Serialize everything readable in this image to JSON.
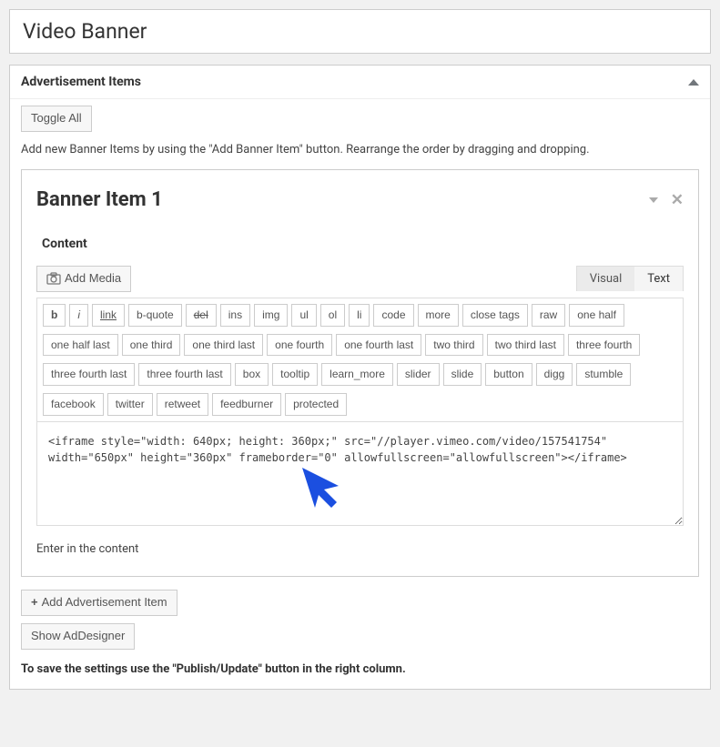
{
  "pageTitle": "Video Banner",
  "section": {
    "title": "Advertisement Items",
    "toggleAllLabel": "Toggle All",
    "helpText": "Add new Banner Items by using the \"Add Banner Item\" button. Rearrange the order by dragging and dropping."
  },
  "bannerItem": {
    "title": "Banner Item 1",
    "contentLabel": "Content",
    "addMediaLabel": "Add Media",
    "tabs": {
      "visual": "Visual",
      "text": "Text",
      "active": "text"
    },
    "quicktags": [
      "b",
      "i",
      "link",
      "b-quote",
      "del",
      "ins",
      "img",
      "ul",
      "ol",
      "li",
      "code",
      "more",
      "close tags",
      "raw",
      "one half",
      "one half last",
      "one third",
      "one third last",
      "one fourth",
      "one fourth last",
      "two third",
      "two third last",
      "three fourth",
      "three fourth last",
      "three fourth last",
      "box",
      "tooltip",
      "learn_more",
      "slider",
      "slide",
      "button",
      "digg",
      "stumble",
      "facebook",
      "twitter",
      "retweet",
      "feedburner",
      "protected"
    ],
    "codeContent": "<iframe style=\"width: 640px; height: 360px;\" src=\"//player.vimeo.com/video/157541754\" width=\"650px\" height=\"360px\" frameborder=\"0\" allowfullscreen=\"allowfullscreen\"></iframe>",
    "hintText": "Enter in the content"
  },
  "buttons": {
    "addAdvertisementItem": "Add Advertisement Item",
    "showDesigner": "Show AdDesigner"
  },
  "footnote": "To save the settings use the \"Publish/Update\" button in the right column.",
  "accent": "#1b4fe0"
}
